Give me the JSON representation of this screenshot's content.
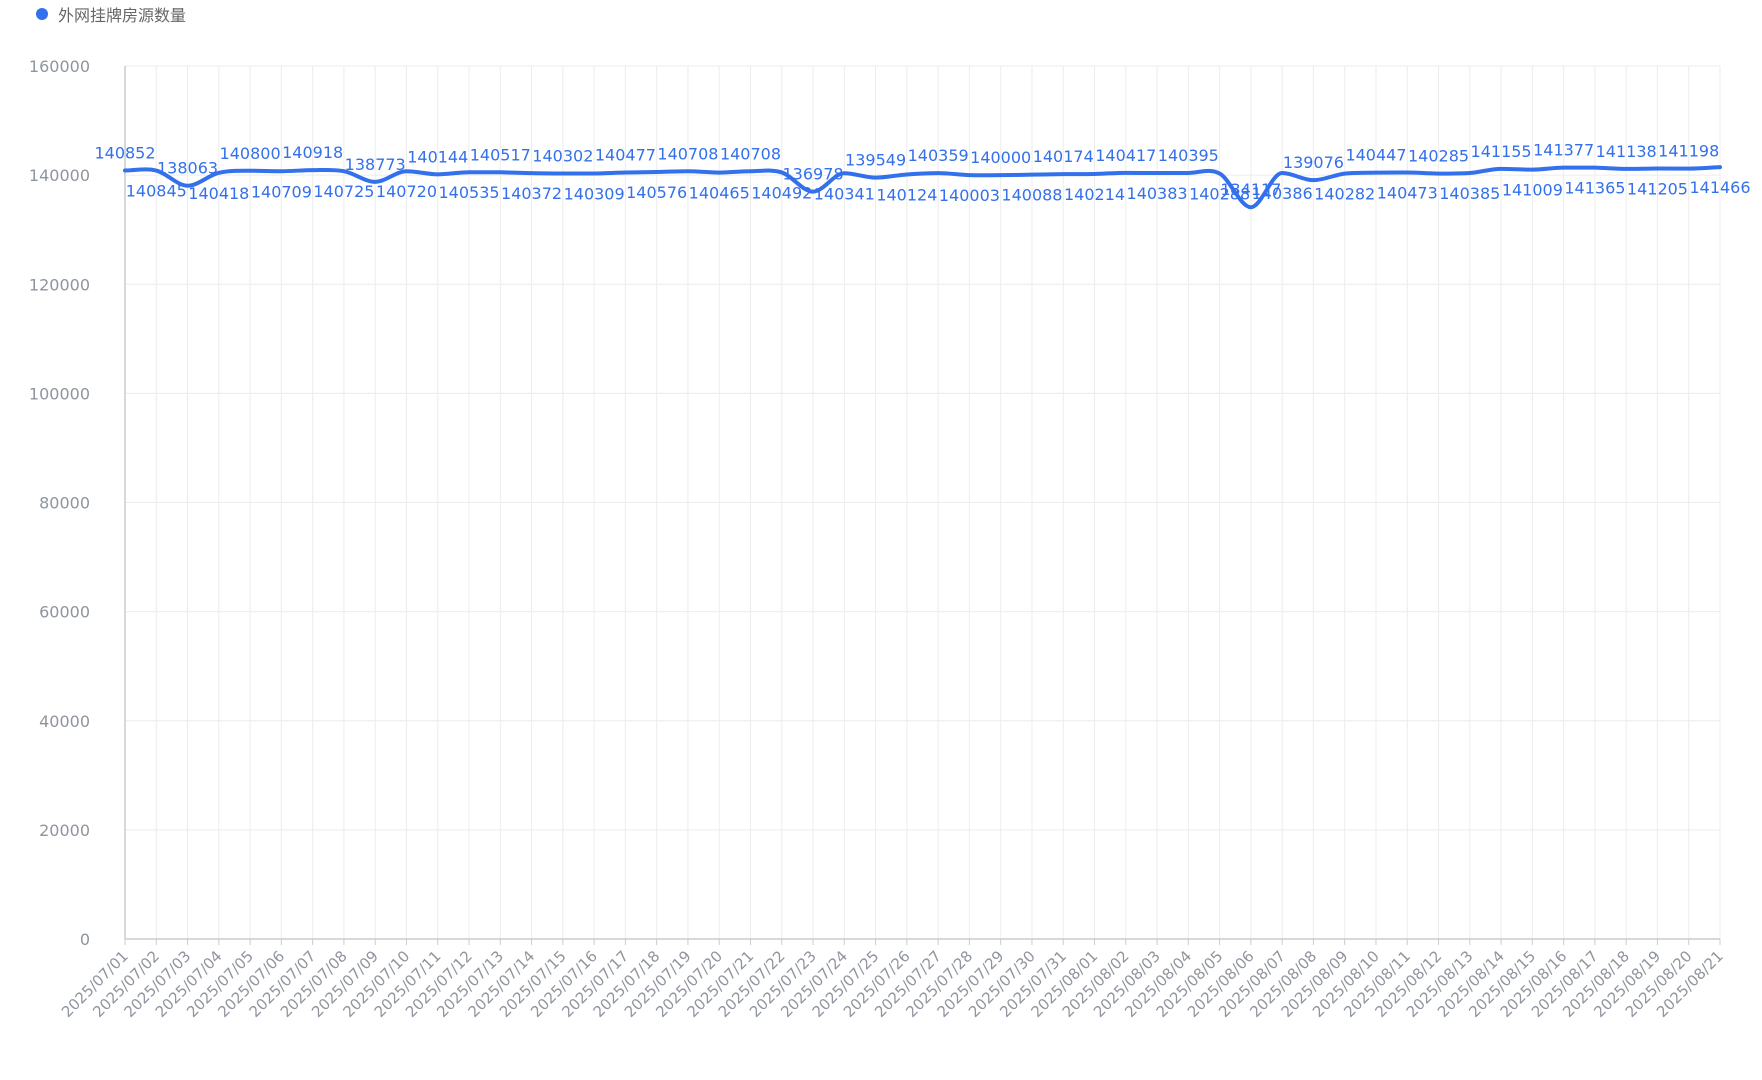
{
  "legend": {
    "label": "外网挂牌房源数量",
    "color": "#3370eb"
  },
  "colors": {
    "line": "#3370eb",
    "grid": "#ececec",
    "axis": "#cccccc",
    "tick_text": "#8f959e",
    "label_text": "#3370eb"
  },
  "chart_data": {
    "type": "line",
    "title": "",
    "xlabel": "",
    "ylabel": "",
    "ylim": [
      0,
      160000
    ],
    "yticks": [
      0,
      20000,
      40000,
      60000,
      80000,
      100000,
      120000,
      140000,
      160000
    ],
    "grid": true,
    "legend_position": "top-left",
    "smooth": true,
    "categories": [
      "2025/07/01",
      "2025/07/02",
      "2025/07/03",
      "2025/07/04",
      "2025/07/05",
      "2025/07/06",
      "2025/07/07",
      "2025/07/08",
      "2025/07/09",
      "2025/07/10",
      "2025/07/11",
      "2025/07/12",
      "2025/07/13",
      "2025/07/14",
      "2025/07/15",
      "2025/07/16",
      "2025/07/17",
      "2025/07/18",
      "2025/07/19",
      "2025/07/20",
      "2025/07/21",
      "2025/07/22",
      "2025/07/23",
      "2025/07/24",
      "2025/07/25",
      "2025/07/26",
      "2025/07/27",
      "2025/07/28",
      "2025/07/29",
      "2025/07/30",
      "2025/07/31",
      "2025/08/01",
      "2025/08/02",
      "2025/08/03",
      "2025/08/04",
      "2025/08/05",
      "2025/08/06",
      "2025/08/07",
      "2025/08/08",
      "2025/08/09",
      "2025/08/10",
      "2025/08/11",
      "2025/08/12",
      "2025/08/13",
      "2025/08/14",
      "2025/08/15",
      "2025/08/16",
      "2025/08/17",
      "2025/08/18",
      "2025/08/19",
      "2025/08/20",
      "2025/08/21"
    ],
    "series": [
      {
        "name": "外网挂牌房源数量",
        "values": [
          140852,
          140845,
          138063,
          140418,
          140800,
          140709,
          140918,
          140725,
          138773,
          140720,
          140144,
          140535,
          140517,
          140372,
          140302,
          140309,
          140477,
          140576,
          140708,
          140465,
          140708,
          140492,
          136978,
          140341,
          139549,
          140124,
          140359,
          140003,
          140000,
          140088,
          140174,
          140214,
          140417,
          140383,
          140395,
          140288,
          134117,
          140386,
          139076,
          140282,
          140447,
          140473,
          140285,
          140385,
          141155,
          141009,
          141377,
          141365,
          141138,
          141205,
          141198,
          141466
        ]
      }
    ]
  }
}
